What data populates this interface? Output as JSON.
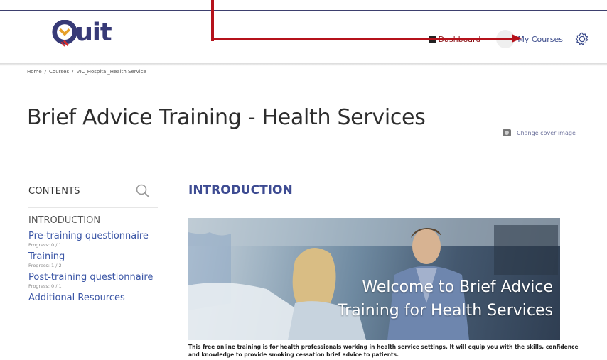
{
  "header": {
    "logo_text": "uit",
    "nav": {
      "dashboard_label": "Dashboard",
      "my_courses_label": "My Courses"
    }
  },
  "breadcrumb": {
    "items": [
      "Home",
      "/",
      "Courses",
      "/",
      "VIC_Hospital_Health Service"
    ]
  },
  "page": {
    "title": "Brief Advice Training - Health Services",
    "change_cover_label": "Change cover image"
  },
  "sidebar": {
    "heading": "CONTENTS",
    "items": [
      {
        "label": "INTRODUCTION",
        "progress": ""
      },
      {
        "label": "Pre-training questionnaire",
        "progress": "Progress: 0 / 1"
      },
      {
        "label": "Training",
        "progress": "Progress: 1 / 2"
      },
      {
        "label": "Post-training questionnaire",
        "progress": "Progress: 0 / 1"
      },
      {
        "label": "Additional Resources",
        "progress": ""
      }
    ]
  },
  "main": {
    "heading": "INTRODUCTION",
    "hero_line1": "Welcome to Brief Advice",
    "hero_line2": "Training for Health Services",
    "intro_text": "This free online training is for health professionals working in health service settings. It will equip you with the skills, confidence and knowledge to provide smoking cessation brief advice to patients."
  },
  "colors": {
    "brand": "#373a77",
    "link": "#3b56a6",
    "annotation_arrow": "#b5121b"
  },
  "icons": [
    "quit-logo-icon",
    "dashboard-icon",
    "gear-icon",
    "camera-icon",
    "search-icon"
  ]
}
